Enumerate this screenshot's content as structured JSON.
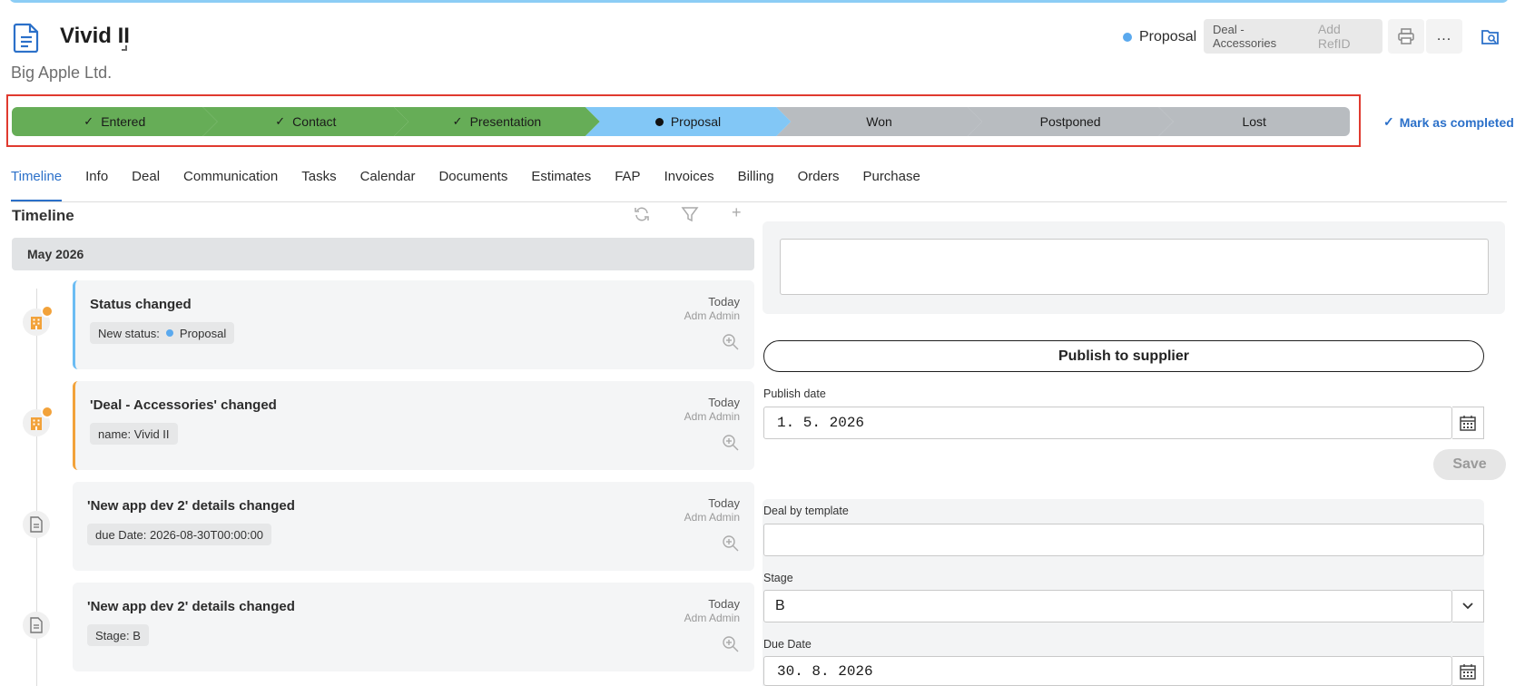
{
  "header": {
    "title": "Vivid II",
    "company": "Big Apple Ltd.",
    "status_label": "Proposal",
    "deal_tag": "Deal - Accessories",
    "refid_placeholder": "Add RefID",
    "more_label": "..."
  },
  "pipeline": {
    "stages": [
      {
        "label": "Entered",
        "state": "done",
        "color": "#66ad57"
      },
      {
        "label": "Contact",
        "state": "done",
        "color": "#66ad57"
      },
      {
        "label": "Presentation",
        "state": "done",
        "color": "#66ad57"
      },
      {
        "label": "Proposal",
        "state": "current",
        "color": "#82c7f6"
      },
      {
        "label": "Won",
        "state": "pending",
        "color": "#b8bcc0"
      },
      {
        "label": "Postponed",
        "state": "pending",
        "color": "#b8bcc0"
      },
      {
        "label": "Lost",
        "state": "pending",
        "color": "#b8bcc0"
      }
    ],
    "mark_completed_label": "Mark as completed"
  },
  "tabs": [
    "Timeline",
    "Info",
    "Deal",
    "Communication",
    "Tasks",
    "Calendar",
    "Documents",
    "Estimates",
    "FAP",
    "Invoices",
    "Billing",
    "Orders",
    "Purchase"
  ],
  "active_tab": "Timeline",
  "timeline": {
    "title": "Timeline",
    "month": "May 2026",
    "events": [
      {
        "title": "Status changed",
        "chip_label": "New status:",
        "chip_value": "Proposal",
        "when": "Today",
        "who": "Adm Admin",
        "accent": "blue",
        "icon": "building-icon"
      },
      {
        "title": "'Deal - Accessories' changed",
        "chip_label": "name: Vivid II",
        "chip_value": "",
        "when": "Today",
        "who": "Adm Admin",
        "accent": "orange",
        "icon": "building-icon"
      },
      {
        "title": "'New app dev 2' details changed",
        "chip_label": "due Date: 2026-08-30T00:00:00",
        "chip_value": "",
        "when": "Today",
        "who": "Adm Admin",
        "accent": "none",
        "icon": "document-icon"
      },
      {
        "title": "'New app dev 2' details changed",
        "chip_label": "Stage: B",
        "chip_value": "",
        "when": "Today",
        "who": "Adm Admin",
        "accent": "none",
        "icon": "document-icon"
      }
    ]
  },
  "right_panel": {
    "publish_button": "Publish to supplier",
    "publish_date_label": "Publish date",
    "publish_date_value": "1. 5. 2026",
    "save_label": "Save",
    "deal_template_label": "Deal by template",
    "deal_template_value": "",
    "stage_label": "Stage",
    "stage_value": "B",
    "due_date_label": "Due Date",
    "due_date_value": "30. 8. 2026"
  }
}
